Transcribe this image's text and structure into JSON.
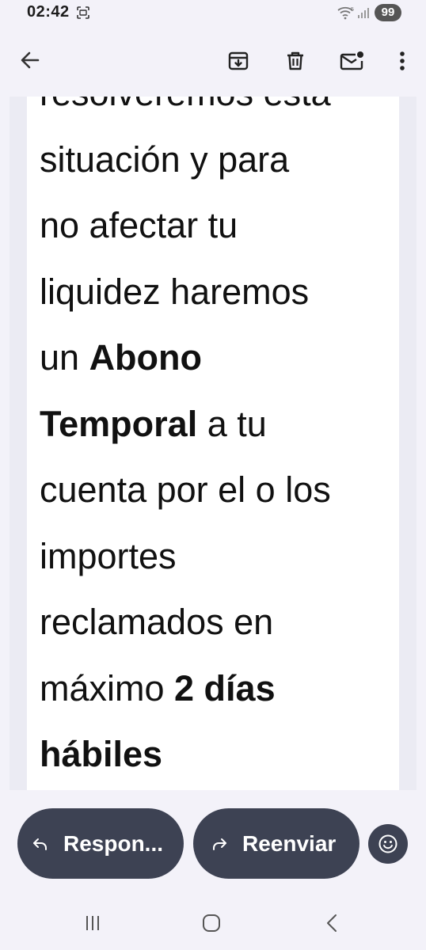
{
  "status_bar": {
    "time": "02:42",
    "battery": "99",
    "icons": [
      "screenshot-icon",
      "wifi-icon",
      "signal-icon"
    ]
  },
  "app_bar": {
    "icons": [
      "back-arrow-icon",
      "archive-icon",
      "trash-icon",
      "mark-unread-icon",
      "more-vert-icon"
    ]
  },
  "email": {
    "partial_top_line": "resolveremos esta",
    "segments": [
      {
        "text": "situación y para",
        "bold": false
      },
      {
        "text": "no afectar tu",
        "bold": false
      },
      {
        "text": "liquidez haremos",
        "bold": false
      },
      {
        "text": "un ",
        "bold": false
      },
      {
        "text": "Abono",
        "bold": true
      },
      {
        "text": "Temporal",
        "bold": true
      },
      {
        "text": " a tu",
        "bold": false
      },
      {
        "text": "cuenta por el o los",
        "bold": false
      },
      {
        "text": "importes",
        "bold": false
      },
      {
        "text": "reclamados en",
        "bold": false
      },
      {
        "text": "máximo ",
        "bold": false
      },
      {
        "text": "2 días",
        "bold": true
      },
      {
        "text": "hábiles",
        "bold": true
      }
    ]
  },
  "actions": {
    "reply_label": "Respon...",
    "forward_label": "Reenviar",
    "reply_icon": "reply-arrow-icon",
    "forward_icon": "forward-arrow-icon",
    "emoji_icon": "smiley-icon"
  },
  "nav_bar": {
    "icons": [
      "recents-icon",
      "home-icon",
      "back-chevron-icon"
    ]
  },
  "colors": {
    "background": "#f3f2f9",
    "card": "#ffffff",
    "pill": "#3d4253",
    "text": "#111111"
  }
}
